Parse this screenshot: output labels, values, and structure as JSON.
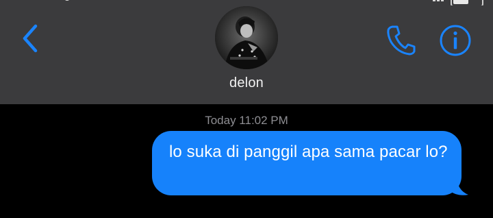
{
  "colors": {
    "header_bg": "#3b3b3d",
    "accent_blue": "#1682fb",
    "icon_blue": "#1a84ff",
    "timestamp_gray": "#8e8e93",
    "background": "#000000"
  },
  "header": {
    "back_icon": "chevron-left-icon",
    "contact_name": "delon",
    "call_icon": "phone-icon",
    "info_icon": "info-circle-icon"
  },
  "conversation": {
    "timestamp": "Today 11:02 PM",
    "messages": [
      {
        "direction": "outgoing",
        "text": "lo suka di panggil apa sama pacar lo?"
      }
    ]
  }
}
